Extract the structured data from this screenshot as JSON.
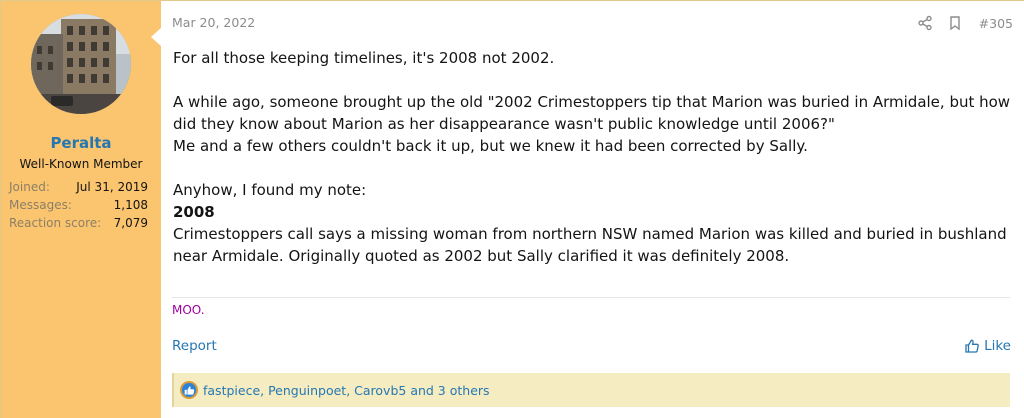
{
  "user": {
    "name": "Peralta",
    "title": "Well-Known Member",
    "stats": [
      {
        "label": "Joined:",
        "value": "Jul 31, 2019"
      },
      {
        "label": "Messages:",
        "value": "1,108"
      },
      {
        "label": "Reaction score:",
        "value": "7,079"
      }
    ]
  },
  "post": {
    "date": "Mar 20, 2022",
    "number": "#305",
    "paragraphs": {
      "p1": "For all those keeping timelines, it's 2008 not 2002.",
      "p2": "A while ago, someone brought up the old \"2002 Crimestoppers tip that Marion was buried in Armidale, but how did they know about Marion as her disappearance wasn't public knowledge until 2006?\"",
      "p3": "Me and a few others couldn't back it up, but we knew it had been corrected by Sally.",
      "p4": "Anyhow, I found my note:",
      "p5_bold": "2008",
      "p6": "Crimestoppers call says a missing woman from northern NSW named Marion was killed and buried in bushland near Armidale. Originally quoted as 2002 but Sally clarified it was definitely 2008."
    },
    "signature": "MOO."
  },
  "actions": {
    "report": "Report",
    "like": "Like"
  },
  "reactions": {
    "text": "fastpiece, Penguinpoet, Carovb5 and 3 others",
    "icon": "like-icon"
  },
  "colors": {
    "sidebar": "#fbc56f",
    "link": "#2577b1",
    "signature": "#a000a0",
    "reactions_bg": "#f5ecc2"
  }
}
